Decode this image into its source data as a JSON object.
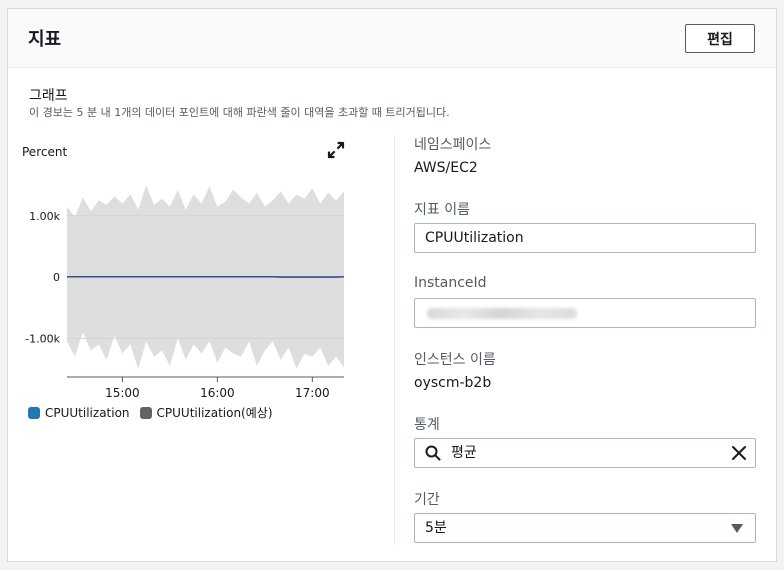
{
  "header": {
    "title": "지표",
    "edit_label": "편집"
  },
  "graph": {
    "title": "그래프",
    "description": "이 경보는 5 분 내 1개의 데이터 포인트에 대해 파란색 줄이 대역을 초과할 때 트리거됩니다."
  },
  "chart_data": {
    "type": "area",
    "ylabel": "Percent",
    "y_ticks": [
      "1.00k",
      "0",
      "-1.00k"
    ],
    "x_ticks": [
      "15:00",
      "16:00",
      "17:00"
    ],
    "x": [
      "14:25",
      "14:30",
      "14:35",
      "14:40",
      "14:45",
      "14:50",
      "14:55",
      "15:00",
      "15:05",
      "15:10",
      "15:15",
      "15:20",
      "15:25",
      "15:30",
      "15:35",
      "15:40",
      "15:45",
      "15:50",
      "15:55",
      "16:00",
      "16:05",
      "16:10",
      "16:15",
      "16:20",
      "16:25",
      "16:30",
      "16:35",
      "16:40",
      "16:45",
      "16:50",
      "16:55",
      "17:00",
      "17:05",
      "17:10",
      "17:15",
      "17:20"
    ],
    "series": [
      {
        "name": "CPUUtilization",
        "color": "#1f77b4",
        "values": [
          5,
          5,
          5,
          5,
          5,
          5,
          5,
          5,
          5,
          5,
          5,
          5,
          5,
          5,
          5,
          5,
          5,
          5,
          5,
          5,
          5,
          5,
          5,
          5,
          5,
          5,
          5,
          0,
          0,
          0,
          0,
          0,
          0,
          0,
          0,
          5
        ]
      },
      {
        "name": "CPUUtilization(예상)",
        "color": "#5f6368",
        "upper": [
          1150,
          980,
          1300,
          1080,
          1250,
          1180,
          1320,
          1200,
          1350,
          1100,
          1500,
          1180,
          1280,
          1150,
          1420,
          1100,
          1350,
          1200,
          1480,
          1150,
          1230,
          1430,
          1300,
          1200,
          1380,
          1150,
          1250,
          1400,
          1200,
          1350,
          1280,
          1450,
          1200,
          1380,
          1250,
          1400
        ],
        "lower": [
          -1050,
          -1300,
          -900,
          -1200,
          -1100,
          -1350,
          -950,
          -1250,
          -1100,
          -1500,
          -1050,
          -1300,
          -1200,
          -1450,
          -1000,
          -1350,
          -1100,
          -1250,
          -1050,
          -1400,
          -1150,
          -1250,
          -1300,
          -1050,
          -1450,
          -1200,
          -1050,
          -1350,
          -1150,
          -1500,
          -1250,
          -1300,
          -1150,
          -1450,
          -1300,
          -1480
        ]
      }
    ],
    "ylim": [
      -1600,
      1700
    ],
    "grid": true
  },
  "legend": {
    "series1": "CPUUtilization",
    "series2": "CPUUtilization(예상)"
  },
  "fields": {
    "namespace": {
      "label": "네임스페이스",
      "value": "AWS/EC2"
    },
    "metric_name": {
      "label": "지표 이름",
      "value": "CPUUtilization"
    },
    "instance_id": {
      "label": "InstanceId"
    },
    "instance_name": {
      "label": "인스턴스 이름",
      "value": "oyscm-b2b"
    },
    "statistic": {
      "label": "통계",
      "value": "평균"
    },
    "period": {
      "label": "기간",
      "value": "5분"
    }
  }
}
